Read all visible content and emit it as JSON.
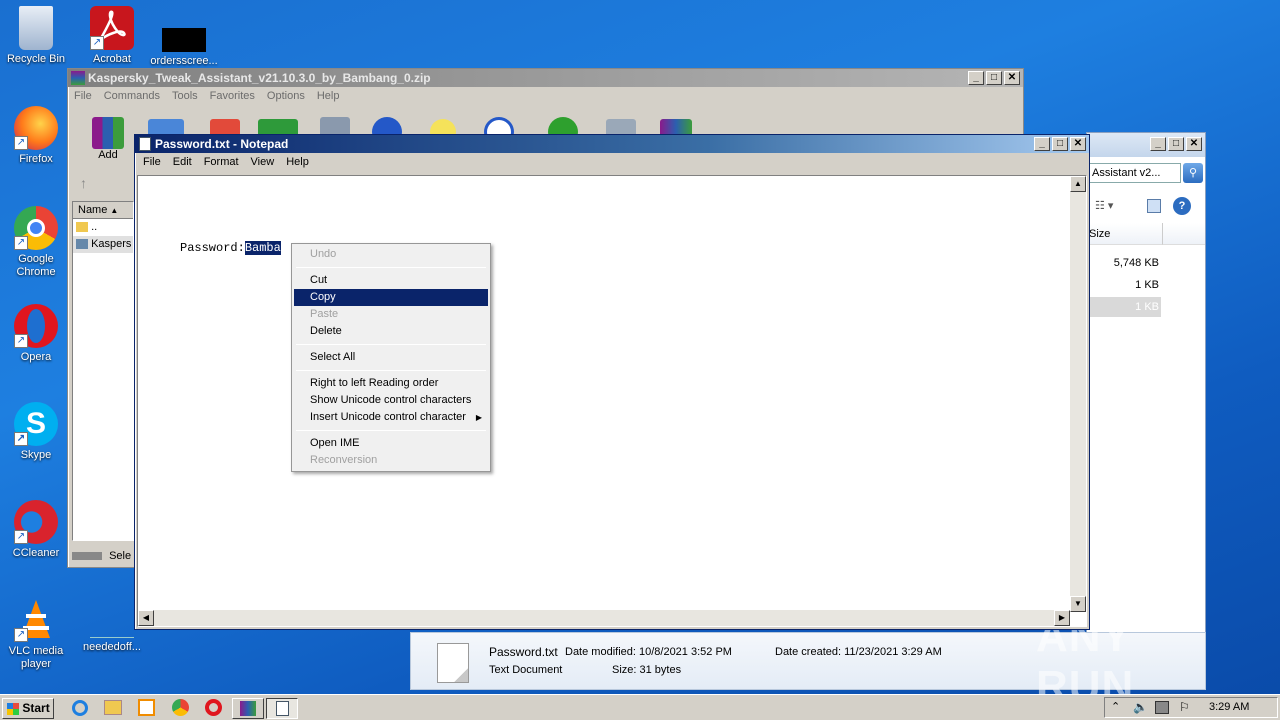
{
  "desktop": {
    "icons": [
      {
        "label": "Recycle Bin",
        "icon": "recycle-bin-icon",
        "color": "#c9d6e8"
      },
      {
        "label": "Acrobat",
        "icon": "acrobat-icon",
        "color": "#c8161d"
      },
      {
        "label": "ordersscree...",
        "icon": "file-thumbnail-icon",
        "color": "#000000"
      },
      {
        "label": "Firefox",
        "icon": "firefox-icon",
        "color": "#ff7a1a"
      },
      {
        "label": "Google Chrome",
        "icon": "chrome-icon",
        "color": "#34a853"
      },
      {
        "label": "Opera",
        "icon": "opera-icon",
        "color": "#e0161e"
      },
      {
        "label": "Skype",
        "icon": "skype-icon",
        "color": "#00aff0"
      },
      {
        "label": "CCleaner",
        "icon": "ccleaner-icon",
        "color": "#d9232d"
      },
      {
        "label": "VLC media player",
        "icon": "vlc-icon",
        "color": "#ff8800"
      },
      {
        "label": "neededoff...",
        "icon": "file-icon",
        "color": "#ffffff"
      }
    ]
  },
  "winrar": {
    "title": "Kaspersky_Tweak_Assistant_v21.10.3.0_by_Bambang_0.zip",
    "menu": [
      "File",
      "Commands",
      "Tools",
      "Favorites",
      "Options",
      "Help"
    ],
    "add_label": "Add",
    "column_name": "Name",
    "rows": [
      "..",
      "Kaspers"
    ],
    "status": "Sele"
  },
  "explorer": {
    "address": "Assistant v2...",
    "column_size": "Size",
    "sizes": [
      "5,748 KB",
      "1 KB",
      "1 KB"
    ],
    "details": {
      "filename": "Password.txt",
      "type": "Text Document",
      "date_modified": "Date modified: 10/8/2021 3:52 PM",
      "date_created": "Date created: 11/23/2021 3:29 AM",
      "size": "Size: 31 bytes"
    }
  },
  "notepad": {
    "title": "Password.txt - Notepad",
    "menu": [
      "File",
      "Edit",
      "Format",
      "View",
      "Help"
    ],
    "text_prefix": "Password:",
    "text_selected": "Bamba"
  },
  "context_menu": {
    "items": [
      {
        "label": "Undo",
        "state": "disabled"
      },
      {
        "sep": true
      },
      {
        "label": "Cut",
        "state": "enabled"
      },
      {
        "label": "Copy",
        "state": "selected"
      },
      {
        "label": "Paste",
        "state": "disabled"
      },
      {
        "label": "Delete",
        "state": "enabled"
      },
      {
        "sep": true
      },
      {
        "label": "Select All",
        "state": "enabled"
      },
      {
        "sep": true
      },
      {
        "label": "Right to left Reading order",
        "state": "enabled"
      },
      {
        "label": "Show Unicode control characters",
        "state": "enabled"
      },
      {
        "label": "Insert Unicode control character",
        "state": "enabled",
        "submenu": true
      },
      {
        "sep": true
      },
      {
        "label": "Open IME",
        "state": "enabled"
      },
      {
        "label": "Reconversion",
        "state": "disabled"
      }
    ]
  },
  "taskbar": {
    "start_label": "Start",
    "clock": "3:29 AM"
  },
  "watermark": "ANY RUN"
}
